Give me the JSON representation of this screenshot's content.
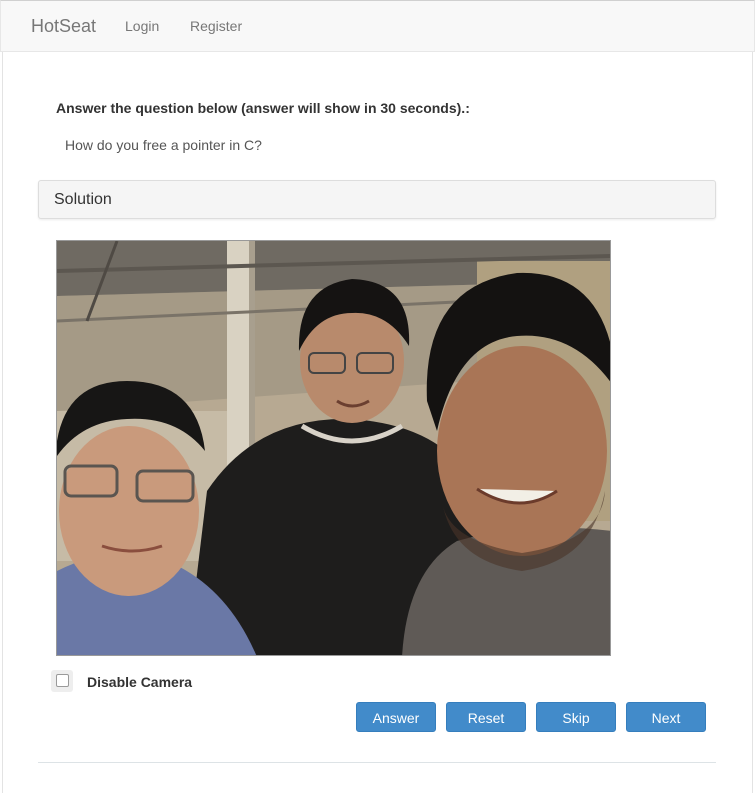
{
  "navbar": {
    "brand": "HotSeat",
    "links": [
      "Login",
      "Register"
    ]
  },
  "question": {
    "prompt": "Answer the question below (answer will show in 30 seconds).:",
    "text": "How do you free a pointer in C?"
  },
  "solution": {
    "title": "Solution"
  },
  "camera": {
    "disable_label": "Disable Camera",
    "disabled": false
  },
  "buttons": {
    "answer": "Answer",
    "reset": "Reset",
    "skip": "Skip",
    "next": "Next"
  },
  "colors": {
    "primary": "#428bca",
    "navbar_bg": "#f8f8f8"
  }
}
